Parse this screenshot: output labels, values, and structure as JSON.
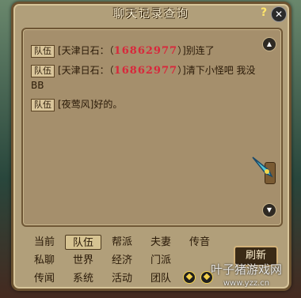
{
  "window": {
    "title": "聊天记录查询",
    "help_label": "?",
    "close_label": "✕"
  },
  "messages": [
    {
      "tag": "队伍",
      "prefix": "[天津日石：（",
      "number": "16862977",
      "suffix": "）]别连了"
    },
    {
      "tag": "队伍",
      "prefix": "[天津日石：（",
      "number": "16862977",
      "suffix": "）]清下小怪吧 我没BB"
    },
    {
      "tag": "队伍",
      "prefix": "[夜莺风]好的。",
      "number": "",
      "suffix": ""
    }
  ],
  "channels": [
    [
      "当前",
      "队伍",
      "帮派",
      "夫妻",
      "传音"
    ],
    [
      "私聊",
      "世界",
      "经济",
      "门派"
    ],
    [
      "传闻",
      "系统",
      "活动",
      "团队"
    ]
  ],
  "active_channel": "队伍",
  "refresh_label": "刷新",
  "watermark": {
    "text": "叶子猪游戏网",
    "url": "www.yzz.cn"
  }
}
